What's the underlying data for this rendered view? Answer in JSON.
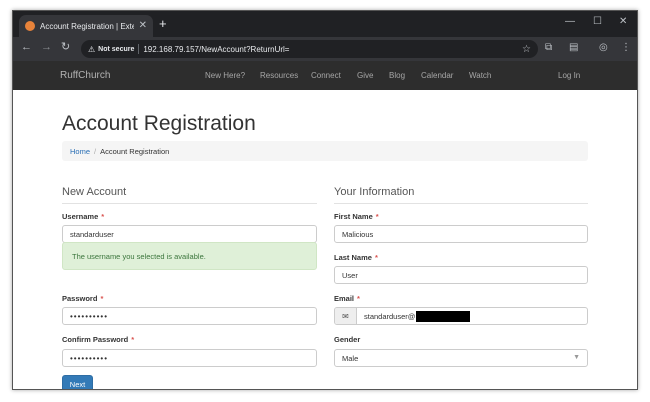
{
  "browser": {
    "tab_title": "Account Registration | Externa",
    "new_tab_symbol": "+",
    "close_tab_symbol": "✕",
    "security_label": "Not secure",
    "url": "192.168.79.157/NewAccount?ReturnUrl=",
    "window_controls": {
      "minimize": "—",
      "maximize": "☐",
      "close": "✕"
    },
    "nav": {
      "back": "←",
      "forward": "→",
      "reload": "↻"
    }
  },
  "site_nav": {
    "brand": "RuffChurch",
    "links": [
      "New Here?",
      "Resources",
      "Connect",
      "Give",
      "Blog",
      "Calendar",
      "Watch"
    ],
    "login": "Log In"
  },
  "page": {
    "title": "Account Registration",
    "breadcrumb": {
      "home": "Home",
      "separator": "/",
      "current": "Account Registration"
    }
  },
  "new_account": {
    "legend": "New Account",
    "username_label": "Username",
    "username_value": "standarduser",
    "username_alert": "The username you selected is available.",
    "password_label": "Password",
    "password_value": "••••••••••",
    "confirm_label": "Confirm Password",
    "confirm_value": "••••••••••",
    "required_mark": "*",
    "next_button": "Next"
  },
  "your_information": {
    "legend": "Your Information",
    "first_name_label": "First Name",
    "first_name_value": "Malicious",
    "last_name_label": "Last Name",
    "last_name_value": "User",
    "email_label": "Email",
    "email_value": "standarduser@",
    "gender_label": "Gender",
    "gender_value": "Male",
    "required_mark": "*"
  },
  "icons": {
    "favicon": "church-favicon",
    "security": "warning-triangle-icon",
    "bookmark": "star-icon",
    "email_addon": "envelope-icon"
  },
  "colors": {
    "site_nav_bg": "#2d2d2d",
    "primary": "#337ab7",
    "alert_bg": "#dff0d8",
    "alert_text": "#3c763d",
    "required": "#d9534f"
  }
}
